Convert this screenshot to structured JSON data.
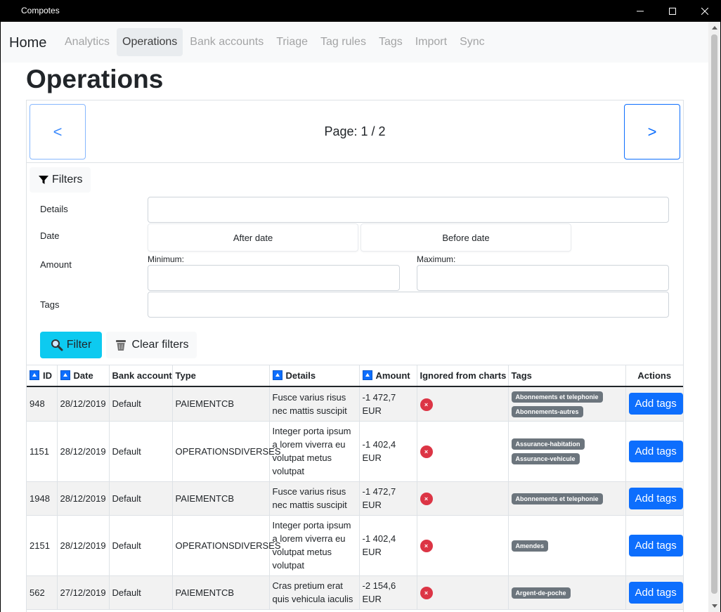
{
  "window": {
    "title": "Compotes"
  },
  "navbar": {
    "brand": "Home",
    "items": [
      {
        "label": "Analytics",
        "active": false
      },
      {
        "label": "Operations",
        "active": true
      },
      {
        "label": "Bank accounts",
        "active": false
      },
      {
        "label": "Triage",
        "active": false
      },
      {
        "label": "Tag rules",
        "active": false
      },
      {
        "label": "Tags",
        "active": false
      },
      {
        "label": "Import",
        "active": false
      },
      {
        "label": "Sync",
        "active": false
      }
    ]
  },
  "page": {
    "title": "Operations"
  },
  "pager": {
    "prev": "<",
    "next": ">",
    "label": "Page: 1 / 2"
  },
  "filters": {
    "toggle_label": "Filters",
    "details_label": "Details",
    "details_value": "",
    "date_label": "Date",
    "after_date": "After date",
    "before_date": "Before date",
    "amount_label": "Amount",
    "minimum_label": "Minimum:",
    "maximum_label": "Maximum:",
    "tags_label": "Tags",
    "filter_button": "Filter",
    "clear_button": "Clear filters"
  },
  "table": {
    "headers": {
      "id": "ID",
      "date": "Date",
      "bank_account": "Bank account",
      "type": "Type",
      "details": "Details",
      "amount": "Amount",
      "ignored": "Ignored from charts",
      "tags": "Tags",
      "actions": "Actions"
    },
    "ignored_glyph": "×",
    "rows": [
      {
        "id": "948",
        "date": "28/12/2019",
        "bank_account": "Default",
        "type": "PAIEMENTCB",
        "details": "Fusce varius risus nec mattis suscipit",
        "amount": "-1 472,7 EUR",
        "tags": [
          "Abonnements et telephonie",
          "Abonnements-autres"
        ],
        "action": "Add tags"
      },
      {
        "id": "1151",
        "date": "28/12/2019",
        "bank_account": "Default",
        "type": "OPERATIONSDIVERSES",
        "details": "Integer porta ipsum a lorem viverra eu volutpat metus volutpat",
        "amount": "-1 402,4 EUR",
        "tags": [
          "Assurance-habitation",
          "Assurance-vehicule"
        ],
        "action": "Add tags"
      },
      {
        "id": "1948",
        "date": "28/12/2019",
        "bank_account": "Default",
        "type": "PAIEMENTCB",
        "details": "Fusce varius risus nec mattis suscipit",
        "amount": "-1 472,7 EUR",
        "tags": [
          "Abonnements et telephonie"
        ],
        "action": "Add tags"
      },
      {
        "id": "2151",
        "date": "28/12/2019",
        "bank_account": "Default",
        "type": "OPERATIONSDIVERSES",
        "details": "Integer porta ipsum a lorem viverra eu volutpat metus volutpat",
        "amount": "-1 402,4 EUR",
        "tags": [
          "Amendes"
        ],
        "action": "Add tags"
      },
      {
        "id": "562",
        "date": "27/12/2019",
        "bank_account": "Default",
        "type": "PAIEMENTCB",
        "details": "Cras pretium erat quis vehicula iaculis",
        "amount": "-2 154,6 EUR",
        "tags": [
          "Argent-de-poche"
        ],
        "action": "Add tags"
      }
    ]
  }
}
